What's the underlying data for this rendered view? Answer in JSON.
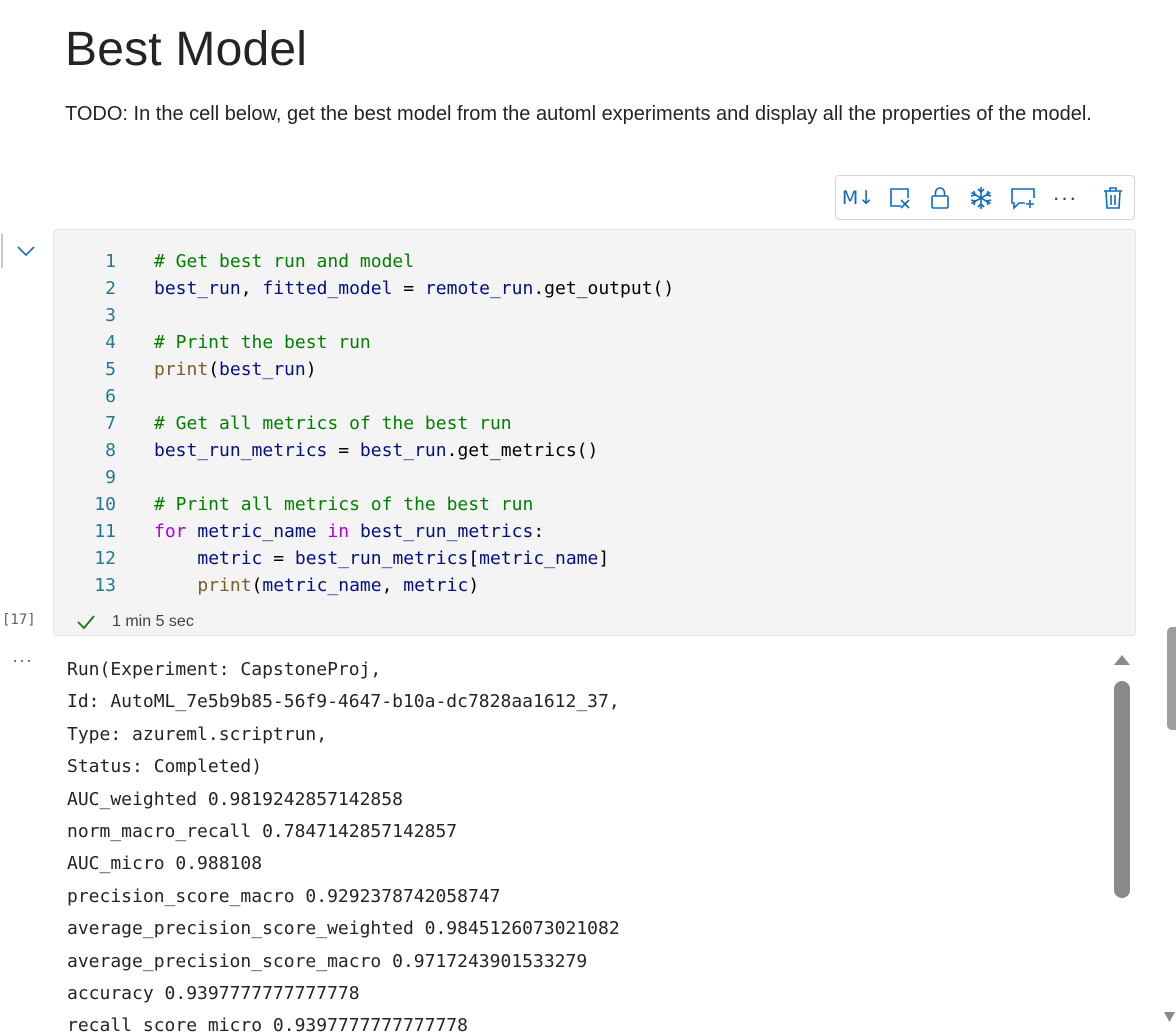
{
  "markdown": {
    "title": "Best Model",
    "text": "TODO: In the cell below, get the best model from the automl experiments and display all the properties of the model."
  },
  "toolbar": {
    "buttons": [
      {
        "name": "markdown-toggle",
        "icon": "markdown-icon",
        "label": "M↓"
      },
      {
        "name": "clear-output",
        "icon": "clear-output-icon"
      },
      {
        "name": "lock-cell",
        "icon": "lock-icon"
      },
      {
        "name": "freeze-cell",
        "icon": "snowflake-icon"
      },
      {
        "name": "add-comment",
        "icon": "comment-add-icon"
      },
      {
        "name": "more-options",
        "icon": "more-icon",
        "label": "···"
      },
      {
        "name": "delete-cell",
        "icon": "trash-icon"
      }
    ],
    "accent_color": "#0f6cbd"
  },
  "cell": {
    "execution_count": "[17]",
    "status_icon": "checkmark-icon",
    "status_color": "#107c10",
    "duration": "1 min 5 sec",
    "code_lines": [
      {
        "n": "1",
        "tokens": [
          {
            "t": "# Get best run and model",
            "c": "cm"
          }
        ]
      },
      {
        "n": "2",
        "tokens": [
          {
            "t": "best_run",
            "c": "var"
          },
          {
            "t": ", ",
            "c": "plain"
          },
          {
            "t": "fitted_model",
            "c": "var"
          },
          {
            "t": " = ",
            "c": "plain"
          },
          {
            "t": "remote_run",
            "c": "var"
          },
          {
            "t": ".get_output()",
            "c": "plain"
          }
        ]
      },
      {
        "n": "3",
        "tokens": []
      },
      {
        "n": "4",
        "tokens": [
          {
            "t": "# Print the best run",
            "c": "cm"
          }
        ]
      },
      {
        "n": "5",
        "tokens": [
          {
            "t": "print",
            "c": "fn"
          },
          {
            "t": "(",
            "c": "plain"
          },
          {
            "t": "best_run",
            "c": "var"
          },
          {
            "t": ")",
            "c": "plain"
          }
        ]
      },
      {
        "n": "6",
        "tokens": []
      },
      {
        "n": "7",
        "tokens": [
          {
            "t": "# Get all metrics of the best run",
            "c": "cm"
          }
        ]
      },
      {
        "n": "8",
        "tokens": [
          {
            "t": "best_run_metrics",
            "c": "var"
          },
          {
            "t": " = ",
            "c": "plain"
          },
          {
            "t": "best_run",
            "c": "var"
          },
          {
            "t": ".get_metrics()",
            "c": "plain"
          }
        ]
      },
      {
        "n": "9",
        "tokens": []
      },
      {
        "n": "10",
        "tokens": [
          {
            "t": "# Print all metrics of the best run",
            "c": "cm"
          }
        ]
      },
      {
        "n": "11",
        "tokens": [
          {
            "t": "for",
            "c": "kw"
          },
          {
            "t": " ",
            "c": "plain"
          },
          {
            "t": "metric_name",
            "c": "var"
          },
          {
            "t": " ",
            "c": "plain"
          },
          {
            "t": "in",
            "c": "kw"
          },
          {
            "t": " ",
            "c": "plain"
          },
          {
            "t": "best_run_metrics",
            "c": "var"
          },
          {
            "t": ":",
            "c": "plain"
          }
        ]
      },
      {
        "n": "12",
        "tokens": [
          {
            "t": "    ",
            "c": "plain"
          },
          {
            "t": "metric",
            "c": "var"
          },
          {
            "t": " = ",
            "c": "plain"
          },
          {
            "t": "best_run_metrics",
            "c": "var"
          },
          {
            "t": "[",
            "c": "plain"
          },
          {
            "t": "metric_name",
            "c": "var"
          },
          {
            "t": "]",
            "c": "plain"
          }
        ]
      },
      {
        "n": "13",
        "tokens": [
          {
            "t": "    ",
            "c": "plain"
          },
          {
            "t": "print",
            "c": "fn"
          },
          {
            "t": "(",
            "c": "plain"
          },
          {
            "t": "metric_name",
            "c": "var"
          },
          {
            "t": ", ",
            "c": "plain"
          },
          {
            "t": "metric",
            "c": "var"
          },
          {
            "t": ")",
            "c": "plain"
          }
        ]
      }
    ]
  },
  "output": {
    "more_label": "···",
    "lines": [
      "Run(Experiment: CapstoneProj,",
      "Id: AutoML_7e5b9b85-56f9-4647-b10a-dc7828aa1612_37,",
      "Type: azureml.scriptrun,",
      "Status: Completed)",
      "AUC_weighted 0.9819242857142858",
      "norm_macro_recall 0.7847142857142857",
      "AUC_micro 0.988108",
      "precision_score_macro 0.9292378742058747",
      "average_precision_score_weighted 0.9845126073021082",
      "average_precision_score_macro 0.9717243901533279",
      "accuracy 0.9397777777777778",
      "recall_score_micro 0.9397777777777778"
    ]
  }
}
